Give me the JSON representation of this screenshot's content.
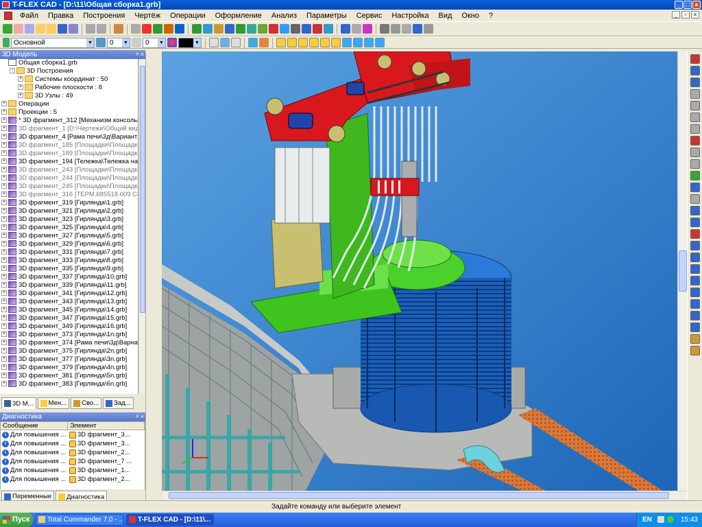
{
  "window": {
    "title": "T-FLEX CAD - [D:\\11\\Общая сборка1.grb]"
  },
  "menu": [
    "Файл",
    "Правка",
    "Построения",
    "Чертёж",
    "Операции",
    "Оформление",
    "Анализ",
    "Параметры",
    "Сервис",
    "Настройка",
    "Вид",
    "Окно",
    "?"
  ],
  "toolbar2": {
    "layer": "Основной",
    "value1": "0",
    "value2": "0"
  },
  "tree_panel": {
    "title": "3D Модель",
    "rows": [
      {
        "text": "Общая сборка1.grb",
        "indent": 0,
        "icon": "doc",
        "exp": ""
      },
      {
        "text": "3D Построения",
        "indent": 1,
        "icon": "folder",
        "exp": "-"
      },
      {
        "text": "Системы координат : 50",
        "indent": 2,
        "icon": "folder",
        "exp": "+"
      },
      {
        "text": "Рабочие плоскости : 8",
        "indent": 2,
        "icon": "folder",
        "exp": "+"
      },
      {
        "text": "3D Узлы : 49",
        "indent": 2,
        "icon": "folder",
        "exp": "+"
      },
      {
        "text": "Операции",
        "indent": 0,
        "icon": "folder",
        "exp": "+"
      },
      {
        "text": "Проекции : 5",
        "indent": 0,
        "icon": "folder",
        "exp": "+"
      },
      {
        "text": "* 3D фрагмент_312 [Механизм консольн",
        "indent": 0,
        "icon": "frag",
        "exp": "+",
        "sel": true
      },
      {
        "text": "3D фрагмент_1 [D:\\Чертежи\\Общий вид",
        "indent": 0,
        "icon": "frag",
        "exp": "+",
        "gray": true
      },
      {
        "text": "3D фрагмент_4 [Рама печи\\3д\\Вариант2",
        "indent": 0,
        "icon": "frag",
        "exp": "+"
      },
      {
        "text": "3D фрагмент_185 [Площадки\\Площадка",
        "indent": 0,
        "icon": "frag",
        "exp": "+",
        "gray": true
      },
      {
        "text": "3D фрагмент_189 [Площадки\\Площадка",
        "indent": 0,
        "icon": "frag",
        "exp": "+",
        "gray": true
      },
      {
        "text": "3D фрагмент_194 [Тележка\\Тележка на",
        "indent": 0,
        "icon": "frag",
        "exp": "+"
      },
      {
        "text": "3D фрагмент_243 [Площадки\\Площадка",
        "indent": 0,
        "icon": "frag",
        "exp": "+",
        "gray": true
      },
      {
        "text": "3D фрагмент_244 [Площадки\\Площадка",
        "indent": 0,
        "icon": "frag",
        "exp": "+",
        "gray": true
      },
      {
        "text": "3D фрагмент_245 [Площадки\\Площадка",
        "indent": 0,
        "icon": "frag",
        "exp": "+",
        "gray": true
      },
      {
        "text": "3D фрагмент_316 [ТЕРМ.685518.009 Сет",
        "indent": 0,
        "icon": "frag",
        "exp": "+",
        "gray": true
      },
      {
        "text": "3D фрагмент_319 [Гирлянда\\1.grb]",
        "indent": 0,
        "icon": "frag",
        "exp": "+"
      },
      {
        "text": "3D фрагмент_321 [Гирлянда\\2.grb]",
        "indent": 0,
        "icon": "frag",
        "exp": "+"
      },
      {
        "text": "3D фрагмент_323 [Гирлянда\\3.grb]",
        "indent": 0,
        "icon": "frag",
        "exp": "+"
      },
      {
        "text": "3D фрагмент_325 [Гирлянда\\4.grb]",
        "indent": 0,
        "icon": "frag",
        "exp": "+"
      },
      {
        "text": "3D фрагмент_327 [Гирлянда\\5.grb]",
        "indent": 0,
        "icon": "frag",
        "exp": "+"
      },
      {
        "text": "3D фрагмент_329 [Гирлянда\\6.grb]",
        "indent": 0,
        "icon": "frag",
        "exp": "+"
      },
      {
        "text": "3D фрагмент_331 [Гирлянда\\7.grb]",
        "indent": 0,
        "icon": "frag",
        "exp": "+"
      },
      {
        "text": "3D фрагмент_333 [Гирлянда\\8.grb]",
        "indent": 0,
        "icon": "frag",
        "exp": "+"
      },
      {
        "text": "3D фрагмент_335 [Гирлянда\\9.grb]",
        "indent": 0,
        "icon": "frag",
        "exp": "+"
      },
      {
        "text": "3D фрагмент_337 [Гирлянда\\10.grb]",
        "indent": 0,
        "icon": "frag",
        "exp": "+"
      },
      {
        "text": "3D фрагмент_339 [Гирлянда\\11.grb]",
        "indent": 0,
        "icon": "frag",
        "exp": "+"
      },
      {
        "text": "3D фрагмент_341 [Гирлянда\\12.grb]",
        "indent": 0,
        "icon": "frag",
        "exp": "+"
      },
      {
        "text": "3D фрагмент_343 [Гирлянда\\13.grb]",
        "indent": 0,
        "icon": "frag",
        "exp": "+"
      },
      {
        "text": "3D фрагмент_345 [Гирлянда\\14.grb]",
        "indent": 0,
        "icon": "frag",
        "exp": "+"
      },
      {
        "text": "3D фрагмент_347 [Гирлянда\\15.grb]",
        "indent": 0,
        "icon": "frag",
        "exp": "+"
      },
      {
        "text": "3D фрагмент_349 [Гирлянда\\16.grb]",
        "indent": 0,
        "icon": "frag",
        "exp": "+"
      },
      {
        "text": "3D фрагмент_373 [Гирлянда\\1n.grb]",
        "indent": 0,
        "icon": "frag",
        "exp": "+"
      },
      {
        "text": "3D фрагмент_374 [Рама печи\\3д\\Варна",
        "indent": 0,
        "icon": "frag",
        "exp": "+"
      },
      {
        "text": "3D фрагмент_375 [Гирлянда\\2n.grb]",
        "indent": 0,
        "icon": "frag",
        "exp": "+"
      },
      {
        "text": "3D фрагмент_377 [Гирлянда\\3n.grb]",
        "indent": 0,
        "icon": "frag",
        "exp": "+"
      },
      {
        "text": "3D фрагмент_379 [Гирлянда\\4n.grb]",
        "indent": 0,
        "icon": "frag",
        "exp": "+"
      },
      {
        "text": "3D фрагмент_381 [Гирлянда\\5n.grb]",
        "indent": 0,
        "icon": "frag",
        "exp": "+"
      },
      {
        "text": "3D фрагмент_383 [Гирлянда\\6n.grb]",
        "indent": 0,
        "icon": "frag",
        "exp": "+"
      }
    ]
  },
  "tree_tabs": [
    "3D М...",
    "Мен...",
    "Сво...",
    "Зад..."
  ],
  "diag_panel": {
    "title": "Диагностика",
    "col_message": "Сообщение",
    "col_element": "Элемент",
    "rows": [
      {
        "msg": "Для повышения ...",
        "el": "3D фрагмент_3..."
      },
      {
        "msg": "Для повышения ...",
        "el": "3D фрагмент_3..."
      },
      {
        "msg": "Для повышения ...",
        "el": "3D фрагмент_2..."
      },
      {
        "msg": "Для повышения ...",
        "el": "3D фрагмент_7 ..."
      },
      {
        "msg": "Для повышения ...",
        "el": "3D фрагмент_1..."
      },
      {
        "msg": "Для повышения ...",
        "el": "3D фрагмент_2..."
      }
    ]
  },
  "bottom_tabs": [
    "Переменные",
    "Диагностика"
  ],
  "status": {
    "message": "Задайте команду или выберите элемент"
  },
  "taskbar": {
    "start": "Пуск",
    "tasks": [
      "Total Commander 7.0 - ...",
      "T-FLEX CAD - [D:\\11\\..."
    ],
    "lang": "EN",
    "clock": "15:43"
  },
  "colors": {
    "viewport_bg": "#2f7fca",
    "red_beam": "#d8181c",
    "green": "#33b81b",
    "blue_furnace": "#1f6fc8",
    "gray_platform": "#b8bab8",
    "cables": "#e8eef4"
  }
}
